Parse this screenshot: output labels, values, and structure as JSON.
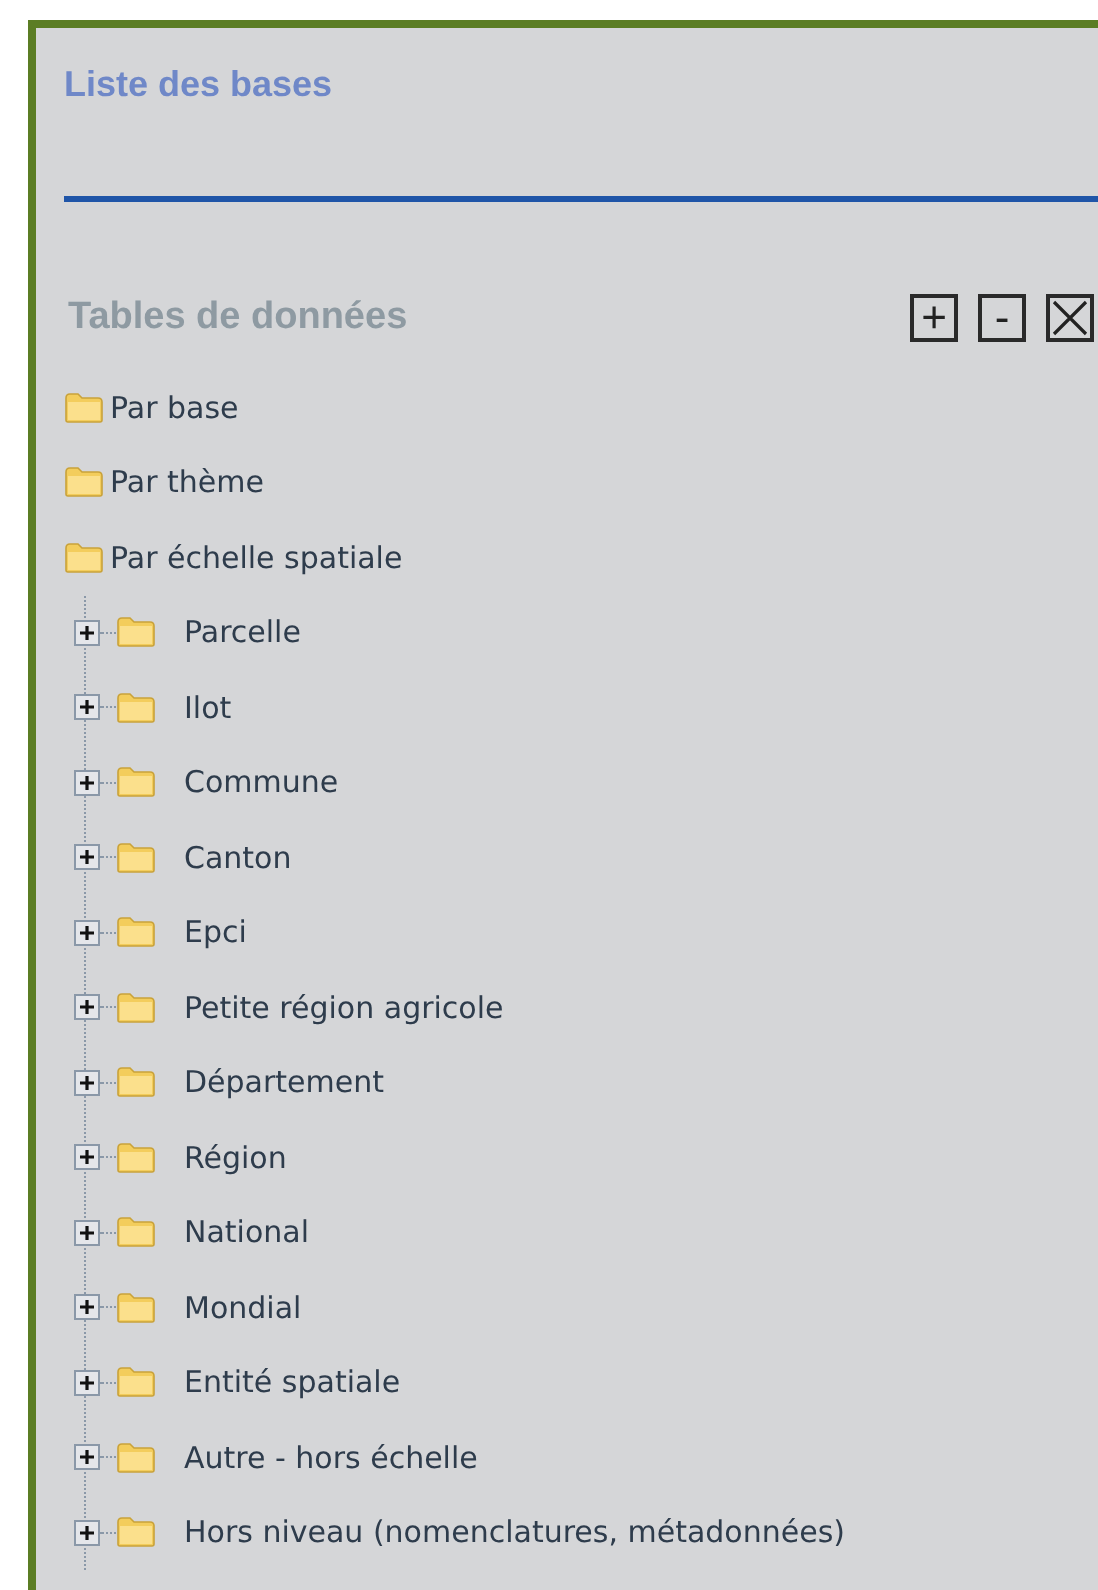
{
  "panel": {
    "title": "Liste des bases"
  },
  "section": {
    "title": "Tables de données"
  },
  "toolbar": [
    {
      "kind": "text",
      "label": "+"
    },
    {
      "kind": "text",
      "label": "-"
    },
    {
      "kind": "close"
    }
  ],
  "tree": [
    {
      "label": "Par base"
    },
    {
      "label": "Par thème"
    },
    {
      "label": "Par échelle spatiale",
      "children": [
        {
          "label": "Parcelle",
          "expanded": false
        },
        {
          "label": "Ilot",
          "expanded": false
        },
        {
          "label": "Commune",
          "expanded": false
        },
        {
          "label": "Canton",
          "expanded": false
        },
        {
          "label": "Epci",
          "expanded": false
        },
        {
          "label": "Petite région agricole",
          "expanded": false
        },
        {
          "label": "Département",
          "expanded": false
        },
        {
          "label": "Région",
          "expanded": false
        },
        {
          "label": "National",
          "expanded": false
        },
        {
          "label": "Mondial",
          "expanded": false
        },
        {
          "label": "Entité spatiale",
          "expanded": false
        },
        {
          "label": "Autre - hors échelle",
          "expanded": false
        },
        {
          "label": "Hors niveau (nomenclatures, métadonnées)",
          "expanded": false
        }
      ]
    }
  ]
}
